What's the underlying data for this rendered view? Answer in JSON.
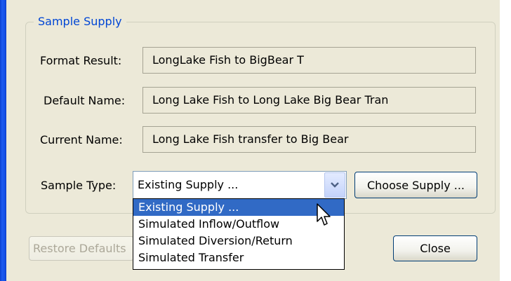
{
  "group": {
    "title": "Sample Supply"
  },
  "fields": {
    "format_result": {
      "label": "Format Result:",
      "value": "LongLake Fish to BigBear T"
    },
    "default_name": {
      "label": "Default Name:",
      "value": "Long Lake Fish to Long Lake Big Bear Tran"
    },
    "current_name": {
      "label": "Current Name:",
      "value": "Long Lake Fish transfer to Big Bear"
    }
  },
  "sample_type": {
    "label": "Sample Type:",
    "selected": "Existing Supply ...",
    "options": [
      "Existing Supply ...",
      "Simulated Inflow/Outflow",
      "Simulated Diversion/Return",
      "Simulated Transfer"
    ]
  },
  "buttons": {
    "choose_supply": "Choose Supply ...",
    "restore_defaults": "Restore Defaults",
    "close": "Close"
  },
  "icons": {
    "dropdown_arrow": "chevron-down-icon",
    "cursor": "mouse-pointer-icon"
  },
  "colors": {
    "group_title": "#0046d5",
    "selection": "#316ac5",
    "window_border": "#1551e6",
    "dialog_bg": "#ece9d8"
  }
}
